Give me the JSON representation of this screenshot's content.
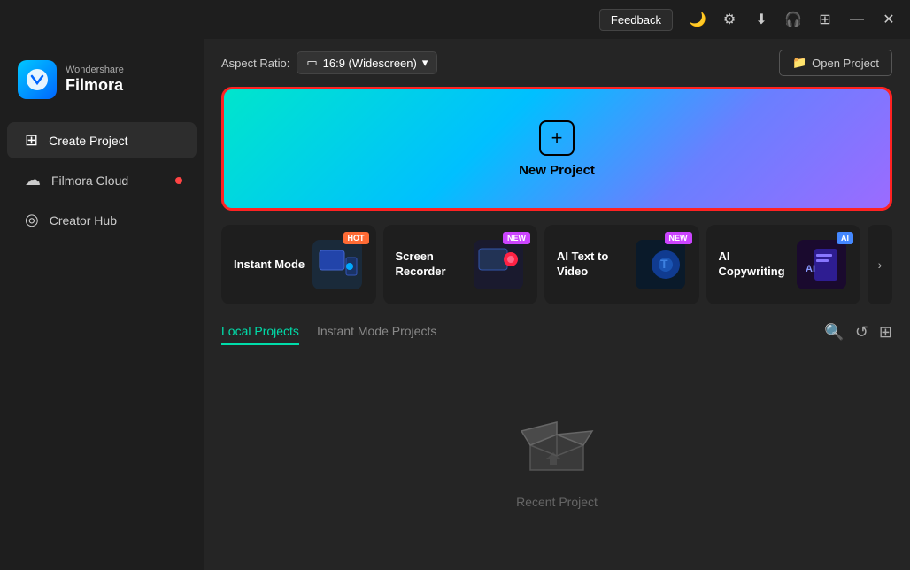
{
  "titlebar": {
    "feedback_label": "Feedback",
    "minimize_label": "—",
    "close_label": "✕"
  },
  "logo": {
    "brand": "Wondershare",
    "product": "Filmora"
  },
  "sidebar": {
    "items": [
      {
        "id": "create-project",
        "label": "Create Project",
        "icon": "⊞",
        "active": true
      },
      {
        "id": "filmora-cloud",
        "label": "Filmora Cloud",
        "icon": "☁",
        "active": false,
        "dot": true
      },
      {
        "id": "creator-hub",
        "label": "Creator Hub",
        "icon": "◎",
        "active": false
      }
    ]
  },
  "toolbar": {
    "aspect_ratio_label": "Aspect Ratio:",
    "aspect_ratio_value": "16:9 (Widescreen)",
    "open_project_label": "Open Project"
  },
  "new_project": {
    "label": "New Project"
  },
  "feature_tiles": [
    {
      "id": "instant-mode",
      "name": "Instant Mode",
      "badge": "HOT",
      "badge_type": "hot",
      "emoji": "🖥"
    },
    {
      "id": "screen-recorder",
      "name": "Screen Recorder",
      "badge": "NEW",
      "badge_type": "new",
      "emoji": "📹"
    },
    {
      "id": "ai-text-to-video",
      "name": "AI Text to Video",
      "badge": "NEW",
      "badge_type": "new",
      "emoji": "🎬"
    },
    {
      "id": "ai-copywriting",
      "name": "AI Copywriting",
      "badge": "AI",
      "badge_type": "ai",
      "emoji": "✍"
    }
  ],
  "projects": {
    "tabs": [
      {
        "id": "local",
        "label": "Local Projects",
        "active": true
      },
      {
        "id": "instant",
        "label": "Instant Mode Projects",
        "active": false
      }
    ]
  },
  "empty_state": {
    "label": "Recent Project"
  }
}
